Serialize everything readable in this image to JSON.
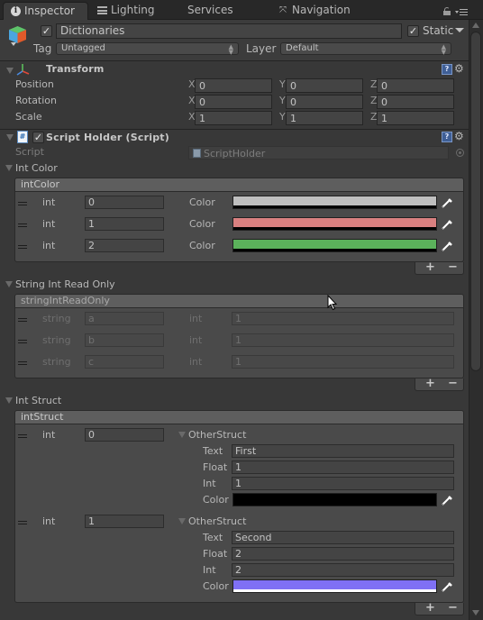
{
  "tabs": [
    {
      "label": "Inspector",
      "icon": "info-icon",
      "active": true
    },
    {
      "label": "Lighting",
      "icon": "lighting-sliders-icon",
      "active": false
    },
    {
      "label": "Services",
      "icon": "",
      "active": false
    },
    {
      "label": "Navigation",
      "icon": "navigation-icon",
      "active": false
    }
  ],
  "tabbar_icons": [
    "lock-icon",
    "menu-icon"
  ],
  "object": {
    "active": true,
    "name": "Dictionaries",
    "static_label": "Static",
    "static_checked": true,
    "tag_label": "Tag",
    "tag_value": "Untagged",
    "layer_label": "Layer",
    "layer_value": "Default"
  },
  "transform": {
    "title": "Transform",
    "rows": [
      {
        "label": "Position",
        "x": "0",
        "y": "0",
        "z": "0"
      },
      {
        "label": "Rotation",
        "x": "0",
        "y": "0",
        "z": "0"
      },
      {
        "label": "Scale",
        "x": "1",
        "y": "1",
        "z": "1"
      }
    ],
    "axis_labels": {
      "x": "X",
      "y": "Y",
      "z": "Z"
    }
  },
  "script_component": {
    "title": "Script Holder (Script)",
    "enabled": true,
    "script_label": "Script",
    "script_value": "ScriptHolder"
  },
  "int_color": {
    "foldout_label": "Int Color",
    "list_header": "intColor",
    "key_label": "int",
    "value_label": "Color",
    "rows": [
      {
        "key": "0",
        "color": "#BFBFBF"
      },
      {
        "key": "1",
        "color": "#D98080"
      },
      {
        "key": "2",
        "color": "#5BB25B"
      }
    ],
    "add_label": "+",
    "remove_label": "−"
  },
  "string_int": {
    "foldout_label": "String Int Read Only",
    "list_header": "stringIntReadOnly",
    "key_label": "string",
    "value_label": "int",
    "rows": [
      {
        "key": "a",
        "value": "1"
      },
      {
        "key": "b",
        "value": "1"
      },
      {
        "key": "c",
        "value": "1"
      }
    ],
    "add_label": "+",
    "remove_label": "−"
  },
  "int_struct": {
    "foldout_label": "Int Struct",
    "list_header": "intStruct",
    "key_label": "int",
    "struct_label": "OtherStruct",
    "field_labels": {
      "text": "Text",
      "float": "Float",
      "int": "Int",
      "color": "Color"
    },
    "rows": [
      {
        "key": "0",
        "text": "First",
        "float": "1",
        "int": "1",
        "color": "#000000",
        "alpha_bar": "#000000"
      },
      {
        "key": "1",
        "text": "Second",
        "float": "2",
        "int": "2",
        "color": "#7F70F5",
        "alpha_bar": "#FFFFFF"
      }
    ],
    "add_label": "+",
    "remove_label": "−"
  }
}
